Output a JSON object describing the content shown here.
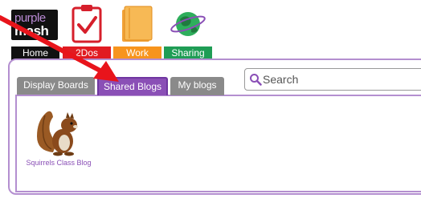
{
  "logo": {
    "line1": "purple",
    "line2": "mash"
  },
  "nav": {
    "home": "Home",
    "todos": "2Dos",
    "work": "Work",
    "sharing": "Sharing"
  },
  "tabs": [
    {
      "label": "Display Boards",
      "active": false
    },
    {
      "label": "Shared Blogs",
      "active": true
    },
    {
      "label": "My blogs",
      "active": false
    }
  ],
  "search": {
    "placeholder": "Search",
    "value": ""
  },
  "blogs": [
    {
      "title": "Squirrels Class Blog",
      "icon": "squirrel-image"
    }
  ],
  "colors": {
    "accent": "#8a4fb6",
    "home": "#111111",
    "todos": "#e11b22",
    "work": "#f7941d",
    "sharing": "#1f9d55",
    "arrow": "#e8141b"
  },
  "icons": {
    "home": "purple-mash-logo",
    "todos": "clipboard-check-icon",
    "work": "folder-icon",
    "sharing": "globe-icon"
  }
}
